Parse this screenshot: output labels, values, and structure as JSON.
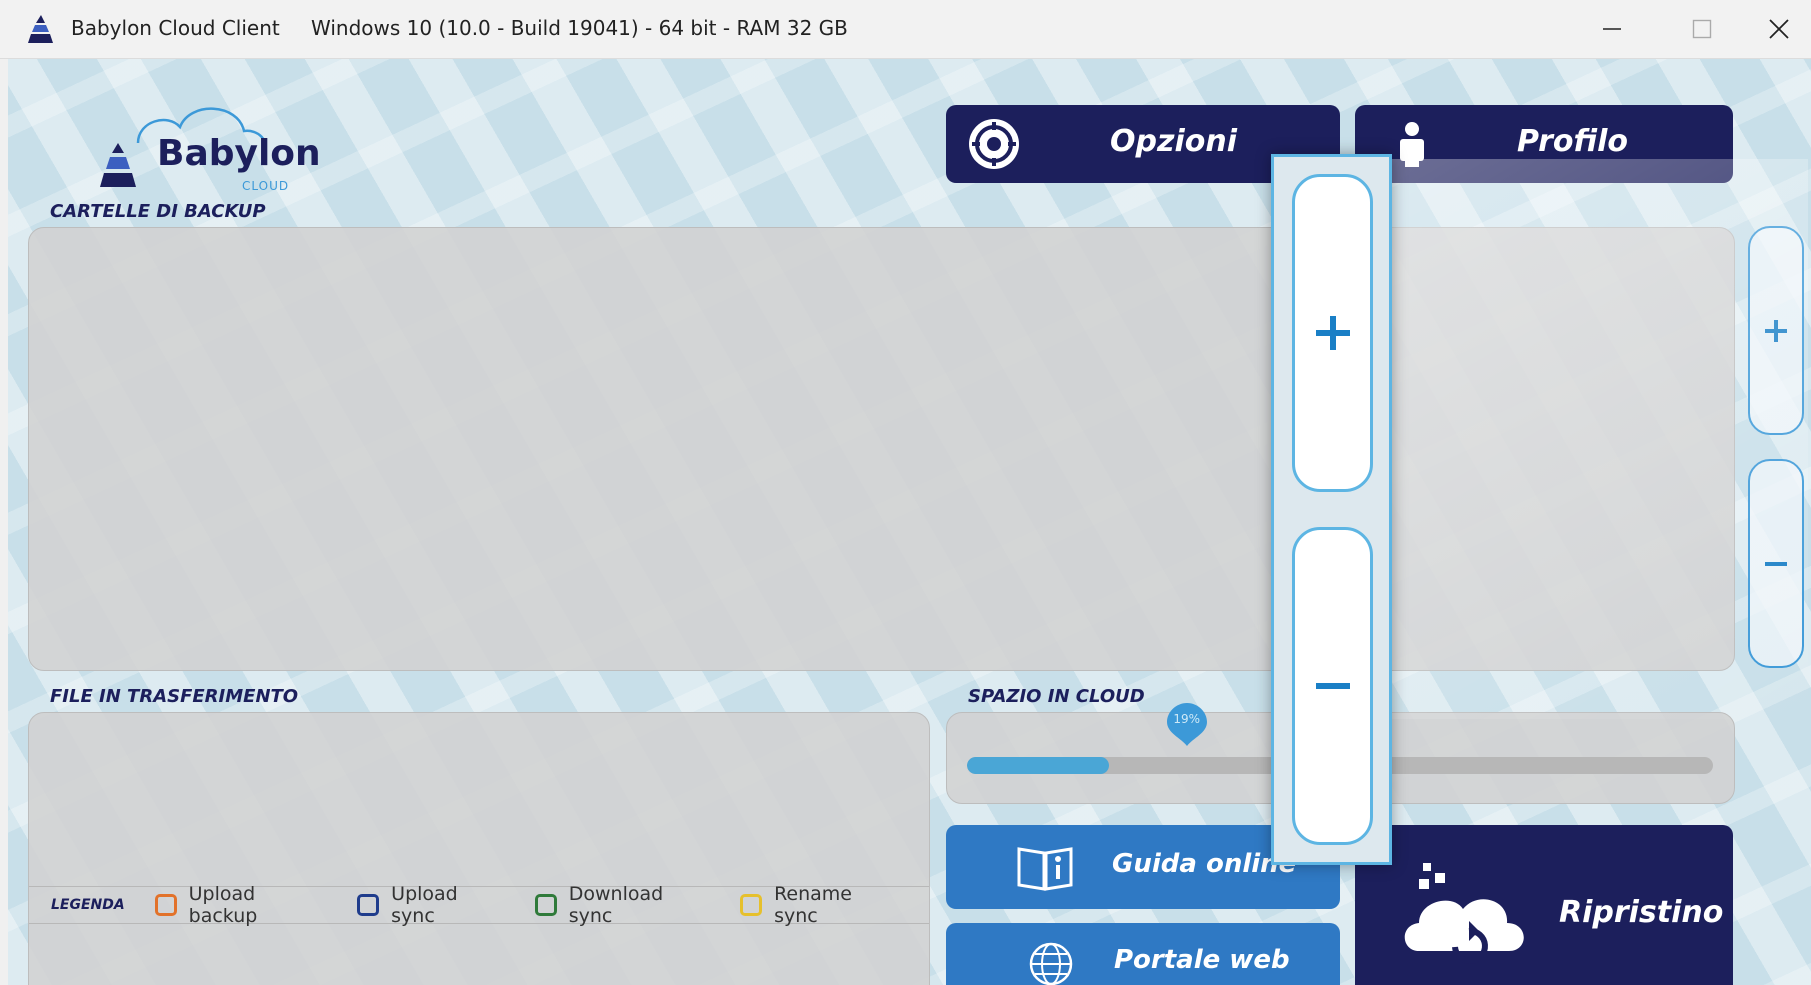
{
  "titlebar": {
    "app_name": "Babylon Cloud Client",
    "system_info": "Windows 10 (10.0 - Build 19041) - 64 bit - RAM 32 GB"
  },
  "logo": {
    "brand": "Babylon",
    "sub": "CLOUD"
  },
  "header": {
    "options_label": "Opzioni",
    "profile_label": "Profilo"
  },
  "backup_folders": {
    "title": "CARTELLE DI BACKUP"
  },
  "transfer": {
    "title": "FILE IN TRASFERIMENTO"
  },
  "legend": {
    "title": "LEGENDA",
    "items": [
      {
        "label": "Upload backup",
        "color": "#e2722a"
      },
      {
        "label": "Upload sync",
        "color": "#1f3c8c"
      },
      {
        "label": "Download sync",
        "color": "#2f7a3a"
      },
      {
        "label": "Rename sync",
        "color": "#e6c02c"
      }
    ]
  },
  "cloud_space": {
    "title": "SPAZIO IN CLOUD",
    "percent_label": "19%",
    "fraction": 0.19
  },
  "actions": {
    "guide_label": "Guida online",
    "web_label": "Portale web",
    "restore_label": "Ripristino"
  },
  "colors": {
    "navy": "#1c1f5c",
    "accent": "#3c99d8",
    "progress": "#4aa6d6"
  }
}
